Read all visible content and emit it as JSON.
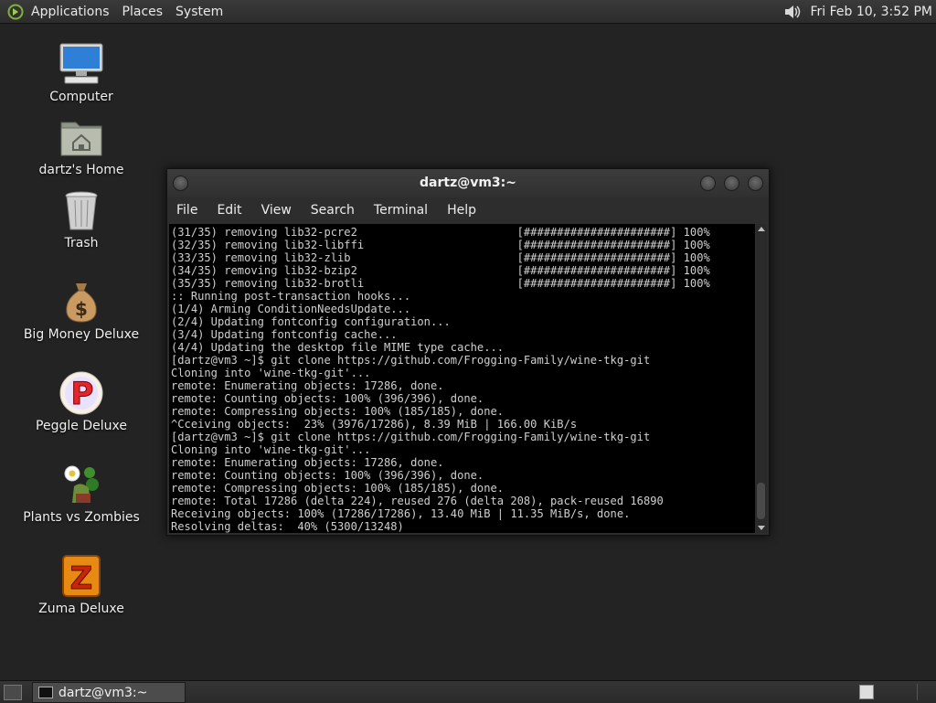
{
  "top_panel": {
    "menus": [
      "Applications",
      "Places",
      "System"
    ],
    "clock": "Fri Feb 10,  3:52 PM"
  },
  "desktop_icons": [
    {
      "label": "Computer",
      "icon": "computer-icon"
    },
    {
      "label": "dartz's Home",
      "icon": "home-folder-icon"
    },
    {
      "label": "Trash",
      "icon": "trash-icon"
    },
    {
      "label": "Big Money Deluxe",
      "icon": "money-bag-icon"
    },
    {
      "label": "Peggle Deluxe",
      "icon": "peggle-icon"
    },
    {
      "label": "Plants vs Zombies",
      "icon": "plants-vs-zombies-icon"
    },
    {
      "label": "Zuma Deluxe",
      "icon": "zuma-icon"
    }
  ],
  "terminal": {
    "title": "dartz@vm3:~",
    "menu": [
      "File",
      "Edit",
      "View",
      "Search",
      "Terminal",
      "Help"
    ],
    "lines": [
      "(31/35) removing lib32-pcre2                        [######################] 100%",
      "(32/35) removing lib32-libffi                       [######################] 100%",
      "(33/35) removing lib32-zlib                         [######################] 100%",
      "(34/35) removing lib32-bzip2                        [######################] 100%",
      "(35/35) removing lib32-brotli                       [######################] 100%",
      ":: Running post-transaction hooks...",
      "(1/4) Arming ConditionNeedsUpdate...",
      "(2/4) Updating fontconfig configuration...",
      "(3/4) Updating fontconfig cache...",
      "(4/4) Updating the desktop file MIME type cache...",
      "[dartz@vm3 ~]$ git clone https://github.com/Frogging-Family/wine-tkg-git",
      "Cloning into 'wine-tkg-git'...",
      "remote: Enumerating objects: 17286, done.",
      "remote: Counting objects: 100% (396/396), done.",
      "remote: Compressing objects: 100% (185/185), done.",
      "^Cceiving objects:  23% (3976/17286), 8.39 MiB | 166.00 KiB/s",
      "[dartz@vm3 ~]$ git clone https://github.com/Frogging-Family/wine-tkg-git",
      "Cloning into 'wine-tkg-git'...",
      "remote: Enumerating objects: 17286, done.",
      "remote: Counting objects: 100% (396/396), done.",
      "remote: Compressing objects: 100% (185/185), done.",
      "remote: Total 17286 (delta 224), reused 276 (delta 208), pack-reused 16890",
      "Receiving objects: 100% (17286/17286), 13.40 MiB | 11.35 MiB/s, done.",
      "Resolving deltas:  40% (5300/13248)"
    ]
  },
  "taskbar": {
    "tasks": [
      "dartz@vm3:~"
    ]
  }
}
